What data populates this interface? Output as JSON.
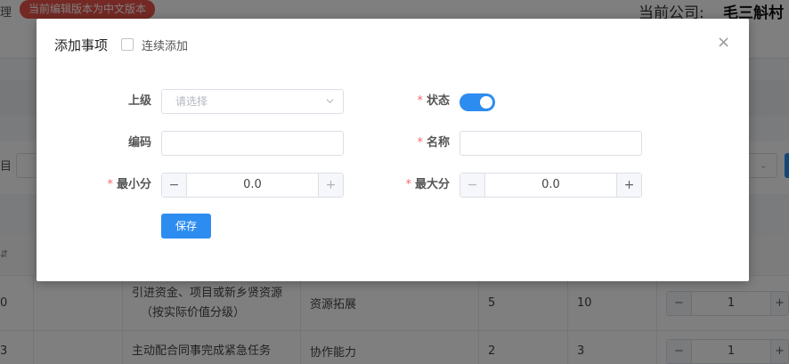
{
  "topbar": {
    "left_fragment": "理",
    "version_badge": "当前编辑版本为中文版本",
    "company_label": "当前公司:",
    "company_name": "毛三斛村"
  },
  "filter": {
    "left_fragment": "目"
  },
  "table": {
    "rows": [
      {
        "index": "0",
        "name_line1": "引进资金、项目或新乡贤资源",
        "name_line2": "（按实际价值分级）",
        "category": "资源拓展",
        "min": "5",
        "max": "10",
        "value": "1"
      },
      {
        "index": "3",
        "name_line1": "主动配合同事完成紧急任务",
        "name_line2": "",
        "category": "协作能力",
        "min": "2",
        "max": "3",
        "value": "1"
      }
    ]
  },
  "modal": {
    "title": "添加事项",
    "continuous_label": "连续添加",
    "continuous_checked": false,
    "close_symbol": "×",
    "fields": {
      "parent_label": "上级",
      "parent_placeholder": "请选择",
      "status_label": "状态",
      "status_on": true,
      "code_label": "编码",
      "code_value": "",
      "name_label": "名称",
      "name_value": "",
      "min_label": "最小分",
      "min_value": "0.0",
      "max_label": "最大分",
      "max_value": "0.0",
      "required_mark": "*"
    },
    "save_label": "保存"
  },
  "colors": {
    "primary": "#2d8cf0",
    "badge": "#e8534a",
    "required": "#f56c6c"
  }
}
